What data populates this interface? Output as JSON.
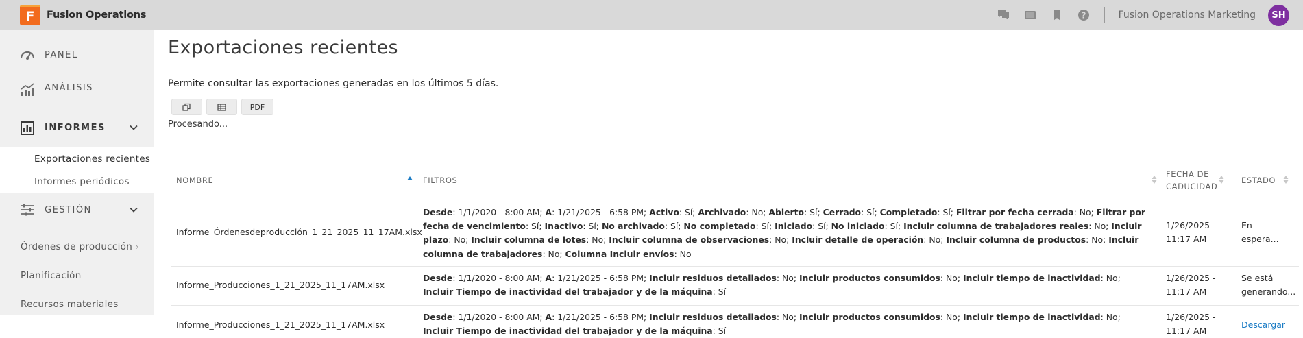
{
  "app": {
    "logo_letter": "F",
    "name": "Fusion Operations",
    "org": "Fusion Operations Marketing",
    "avatar": "SH"
  },
  "topbar": {
    "icons": [
      "chat-icon",
      "video-icon",
      "bookmark-icon",
      "help-icon"
    ]
  },
  "sidebar": {
    "panel": "PANEL",
    "analysis": "ANÁLISIS",
    "reports": "INFORMES",
    "sub_recent": "Exportaciones recientes",
    "sub_periodic": "Informes periódicos",
    "management": "GESTIÓN",
    "orders": "Órdenes de producción",
    "planning": "Planificación",
    "resources": "Recursos materiales"
  },
  "page": {
    "title": "Exportaciones recientes",
    "description": "Permite consultar las exportaciones generadas en los últimos 5 días.",
    "btn_pdf": "PDF",
    "processing": "Procesando..."
  },
  "table": {
    "headers": {
      "name": "NOMBRE",
      "filters": "FILTROS",
      "expiry_1": "FECHA DE",
      "expiry_2": "CADUCIDAD",
      "status": "ESTADO"
    },
    "rows": [
      {
        "name": "Informe_Órdenesdeproducción_1_21_2025_11_17AM.xlsx",
        "filters": [
          [
            "Desde",
            "1/1/2020 - 8:00 AM"
          ],
          [
            "A",
            "1/21/2025 - 6:58 PM"
          ],
          [
            "Activo",
            "Sí"
          ],
          [
            "Archivado",
            "No"
          ],
          [
            "Abierto",
            "Sí"
          ],
          [
            "Cerrado",
            "Sí"
          ],
          [
            "Completado",
            "Sí"
          ],
          [
            "Filtrar por fecha cerrada",
            "No"
          ],
          [
            "Filtrar por fecha de vencimiento",
            "Sí"
          ],
          [
            "Inactivo",
            "Sí"
          ],
          [
            "No archivado",
            "Sí"
          ],
          [
            "No completado",
            "Sí"
          ],
          [
            "Iniciado",
            "Sí"
          ],
          [
            "No iniciado",
            "Sí"
          ],
          [
            "Incluir columna de trabajadores reales",
            "No"
          ],
          [
            "Incluir plazo",
            "No"
          ],
          [
            "Incluir columna de lotes",
            "No"
          ],
          [
            "Incluir columna de observaciones",
            "No"
          ],
          [
            "Incluir detalle de operación",
            "No"
          ],
          [
            "Incluir columna de productos",
            "No"
          ],
          [
            "Incluir columna de trabajadores",
            "No"
          ],
          [
            "Columna Incluir envíos",
            "No"
          ]
        ],
        "expiry_date": "1/26/2025 -",
        "expiry_time": "11:17 AM",
        "status_1": "En",
        "status_2": "espera..."
      },
      {
        "name": "Informe_Producciones_1_21_2025_11_17AM.xlsx",
        "filters": [
          [
            "Desde",
            "1/1/2020 - 8:00 AM"
          ],
          [
            "A",
            "1/21/2025 - 6:58 PM"
          ],
          [
            "Incluir residuos detallados",
            "No"
          ],
          [
            "Incluir productos consumidos",
            "No"
          ],
          [
            "Incluir tiempo de inactividad",
            "No"
          ],
          [
            "Incluir Tiempo de inactividad del trabajador y de la máquina",
            "Sí"
          ]
        ],
        "expiry_date": "1/26/2025 -",
        "expiry_time": "11:17 AM",
        "status_1": "Se está",
        "status_2": "generando..."
      },
      {
        "name": "Informe_Producciones_1_21_2025_11_17AM.xlsx",
        "filters": [
          [
            "Desde",
            "1/1/2020 - 8:00 AM"
          ],
          [
            "A",
            "1/21/2025 - 6:58 PM"
          ],
          [
            "Incluir residuos detallados",
            "No"
          ],
          [
            "Incluir productos consumidos",
            "No"
          ],
          [
            "Incluir tiempo de inactividad",
            "No"
          ],
          [
            "Incluir Tiempo de inactividad del trabajador y de la máquina",
            "Sí"
          ]
        ],
        "expiry_date": "1/26/2025 -",
        "expiry_time": "11:17 AM",
        "status_link": "Descargar"
      }
    ]
  },
  "colors": {
    "accent": "#1a7bc4",
    "logo": "#f26b1d",
    "avatar": "#7e2fa0"
  }
}
